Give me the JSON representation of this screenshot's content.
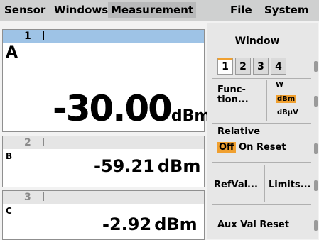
{
  "menu": {
    "items": [
      {
        "label": "Sensor",
        "active": false
      },
      {
        "label": "Windows",
        "active": false
      },
      {
        "label": "Measurement",
        "active": true
      },
      {
        "label": "File",
        "active": false
      },
      {
        "label": "System",
        "active": false
      }
    ]
  },
  "windows": [
    {
      "number": "1",
      "letter": "A",
      "value": "-30.00",
      "unit": "dBm",
      "active": true
    },
    {
      "number": "2",
      "letter": "B",
      "value": "-59.21",
      "unit": "dBm",
      "active": false
    },
    {
      "number": "3",
      "letter": "C",
      "value": "-2.92",
      "unit": "dBm",
      "active": false
    }
  ],
  "panel": {
    "title": "Window",
    "tabs": [
      "1",
      "2",
      "3",
      "4"
    ],
    "active_tab": "1",
    "function_label": "Func-\ntion...",
    "unit_options": [
      "W",
      "dBm",
      "dBµV"
    ],
    "selected_unit": "dBm",
    "relative": {
      "label": "Relative",
      "off": "Off",
      "on": "On",
      "reset": "Reset",
      "selected": "Off"
    },
    "refval_label": "RefVal...",
    "limits_label": "Limits...",
    "aux_reset_label": "Aux Val Reset"
  },
  "colors": {
    "accent": "#f0a030",
    "active_header": "#9ec3e6",
    "menu_bg": "#cfd0d0"
  }
}
